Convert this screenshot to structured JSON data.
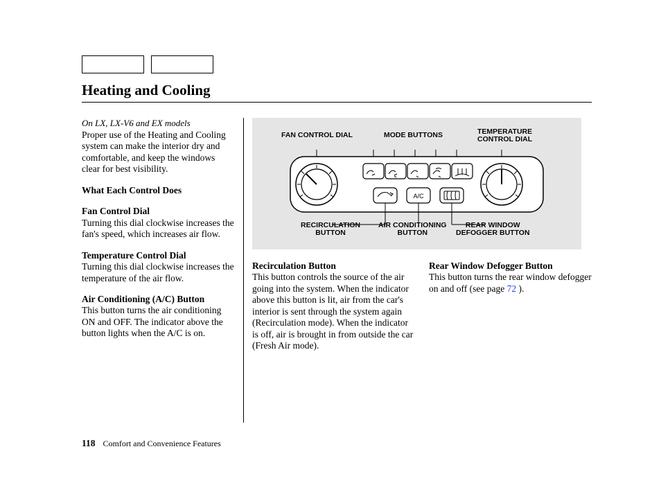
{
  "title": "Heating and Cooling",
  "model_note": "On LX, LX-V6 and EX models",
  "intro": "Proper use of the Heating and Cooling system can make the interior dry and comfortable, and keep the windows clear for best visibility.",
  "section_head": "What Each Control Does",
  "controls": {
    "fan_dial": {
      "head": "Fan Control Dial",
      "body": "Turning this dial clockwise increases the fan's speed, which increases air flow."
    },
    "temp_dial": {
      "head": "Temperature Control Dial",
      "body": "Turning this dial clockwise increases the temperature of the air flow."
    },
    "ac_button": {
      "head": "Air Conditioning (A/C) Button",
      "body": "This button turns the air condi­tioning ON and OFF. The indicator above the button lights when the A/C is on."
    },
    "recirc": {
      "head": "Recirculation Button",
      "body": "This button controls the source of the air going into the system. When the indicator above this button is lit, air from the car's interior is sent through the system again (Recircula­tion mode). When the indicator is off, air is brought in from outside the car (Fresh Air mode)."
    },
    "rear_defog": {
      "head": "Rear Window Defogger Button",
      "body_a": "This button turns the rear window defogger on and off (see page ",
      "page_ref": "72",
      "body_b": " )."
    }
  },
  "diagram_labels": {
    "fan": "FAN CONTROL DIAL",
    "mode": "MODE BUTTONS",
    "temp_a": "TEMPERATURE",
    "temp_b": "CONTROL DIAL",
    "recirc_a": "RECIRCULATION",
    "recirc_b": "BUTTON",
    "ac_a": "AIR CONDITIONING",
    "ac_b": "BUTTON",
    "rear_a": "REAR WINDOW",
    "rear_b": "DEFOGGER BUTTON",
    "ac_btn_text": "A/C"
  },
  "footer": {
    "page_number": "118",
    "section": "Comfort and Convenience Features"
  }
}
